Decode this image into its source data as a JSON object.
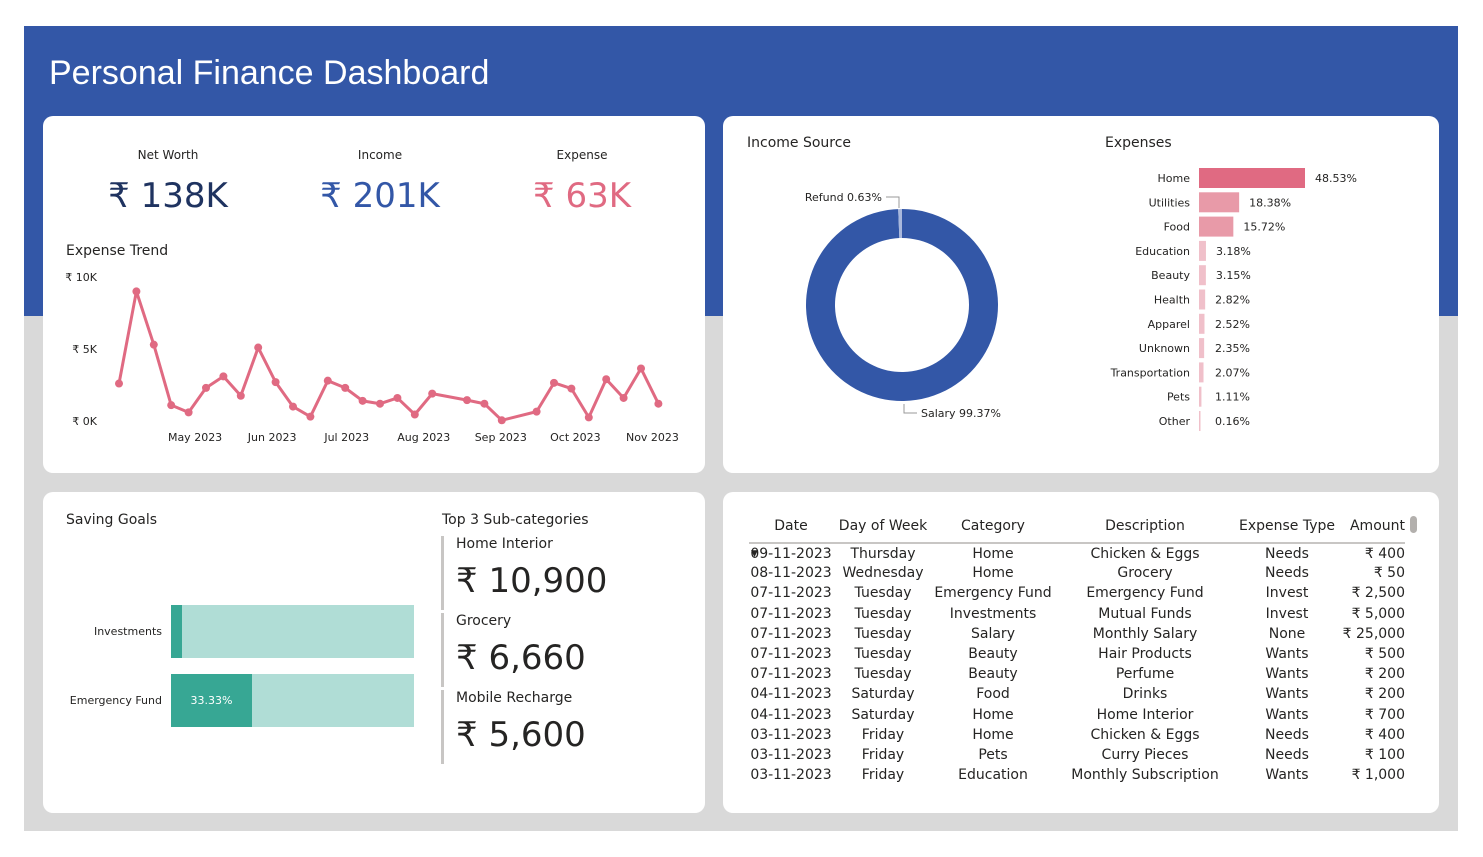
{
  "header": {
    "title": "Personal Finance Dashboard"
  },
  "colors": {
    "banner": "#3357a7",
    "expense": "#e06a82",
    "networth": "#1f3360",
    "income": "#3357a7",
    "goal_fill": "#37a794",
    "goal_track": "#b0ddd6"
  },
  "kpis": [
    {
      "label": "Net Worth",
      "value": "₹ 138K",
      "color": "#1f3360"
    },
    {
      "label": "Income",
      "value": "₹ 201K",
      "color": "#3357a7"
    },
    {
      "label": "Expense",
      "value": "₹ 63K",
      "color": "#e06a82"
    }
  ],
  "chart_data": [
    {
      "type": "line",
      "title": "Expense Trend",
      "ylim": [
        0,
        10000
      ],
      "yticks": [
        "₹ 0K",
        "₹ 5K",
        "₹ 10K"
      ],
      "xticks": [
        "May 2023",
        "Jun 2023",
        "Jul 2023",
        "Aug 2023",
        "Sep 2023",
        "Oct 2023",
        "Nov 2023"
      ],
      "x": [
        "2023-04-02",
        "2023-04-09",
        "2023-04-16",
        "2023-04-23",
        "2023-04-30",
        "2023-05-07",
        "2023-05-14",
        "2023-05-21",
        "2023-05-28",
        "2023-06-04",
        "2023-06-11",
        "2023-06-18",
        "2023-06-25",
        "2023-07-02",
        "2023-07-09",
        "2023-07-16",
        "2023-07-23",
        "2023-07-30",
        "2023-08-06",
        "2023-08-20",
        "2023-08-27",
        "2023-09-03",
        "2023-09-17",
        "2023-09-24",
        "2023-10-01",
        "2023-10-08",
        "2023-10-15",
        "2023-10-22",
        "2023-10-29",
        "2023-11-05"
      ],
      "y": [
        2600,
        9000,
        5300,
        1100,
        600,
        2300,
        3100,
        1750,
        5100,
        2700,
        1000,
        300,
        2800,
        2300,
        1400,
        1200,
        1600,
        450,
        1900,
        1450,
        1200,
        50,
        650,
        2650,
        2250,
        250,
        2900,
        1600,
        3650,
        1200
      ]
    },
    {
      "type": "pie",
      "title": "Income Source",
      "categories": [
        "Salary",
        "Refund"
      ],
      "values": [
        99.37,
        0.63
      ],
      "labels": [
        "Salary 99.37%",
        "Refund 0.63%"
      ],
      "colors": [
        "#3357a7",
        "#a9b8dc"
      ]
    },
    {
      "type": "bar",
      "title": "Expenses",
      "orientation": "horizontal",
      "categories": [
        "Home",
        "Utilities",
        "Food",
        "Education",
        "Beauty",
        "Health",
        "Apparel",
        "Unknown",
        "Transportation",
        "Pets",
        "Other"
      ],
      "values": [
        48.53,
        18.38,
        15.72,
        3.18,
        3.15,
        2.82,
        2.52,
        2.35,
        2.07,
        1.11,
        0.16
      ],
      "labels": [
        "48.53%",
        "18.38%",
        "15.72%",
        "3.18%",
        "3.15%",
        "2.82%",
        "2.52%",
        "2.35%",
        "2.07%",
        "1.11%",
        "0.16%"
      ]
    }
  ],
  "saving_goals": {
    "title": "Saving Goals",
    "items": [
      {
        "label": "Investments",
        "progress": 4.5,
        "text": ""
      },
      {
        "label": "Emergency Fund",
        "progress": 33.33,
        "text": "33.33%"
      }
    ]
  },
  "top_sub": {
    "title": "Top 3 Sub-categories",
    "items": [
      {
        "name": "Home Interior",
        "value": "₹ 10,900"
      },
      {
        "name": "Grocery",
        "value": "₹ 6,660"
      },
      {
        "name": "Mobile Recharge",
        "value": "₹ 5,600"
      }
    ]
  },
  "table": {
    "columns": [
      "Date",
      "Day of Week",
      "Category",
      "Description",
      "Expense Type",
      "Amount"
    ],
    "rows": [
      [
        "09-11-2023",
        "Thursday",
        "Home",
        "Chicken & Eggs",
        "Needs",
        "₹ 400"
      ],
      [
        "08-11-2023",
        "Wednesday",
        "Home",
        "Grocery",
        "Needs",
        "₹ 50"
      ],
      [
        "07-11-2023",
        "Tuesday",
        "Emergency Fund",
        "Emergency Fund",
        "Invest",
        "₹ 2,500"
      ],
      [
        "07-11-2023",
        "Tuesday",
        "Investments",
        "Mutual Funds",
        "Invest",
        "₹ 5,000"
      ],
      [
        "07-11-2023",
        "Tuesday",
        "Salary",
        "Monthly Salary",
        "None",
        "₹ 25,000"
      ],
      [
        "07-11-2023",
        "Tuesday",
        "Beauty",
        "Hair Products",
        "Wants",
        "₹ 500"
      ],
      [
        "07-11-2023",
        "Tuesday",
        "Beauty",
        "Perfume",
        "Wants",
        "₹ 200"
      ],
      [
        "04-11-2023",
        "Saturday",
        "Food",
        "Drinks",
        "Wants",
        "₹ 200"
      ],
      [
        "04-11-2023",
        "Saturday",
        "Home",
        "Home Interior",
        "Wants",
        "₹ 700"
      ],
      [
        "03-11-2023",
        "Friday",
        "Home",
        "Chicken & Eggs",
        "Needs",
        "₹ 400"
      ],
      [
        "03-11-2023",
        "Friday",
        "Pets",
        "Curry Pieces",
        "Needs",
        "₹ 100"
      ],
      [
        "03-11-2023",
        "Friday",
        "Education",
        "Monthly Subscription",
        "Wants",
        "₹ 1,000"
      ]
    ]
  }
}
